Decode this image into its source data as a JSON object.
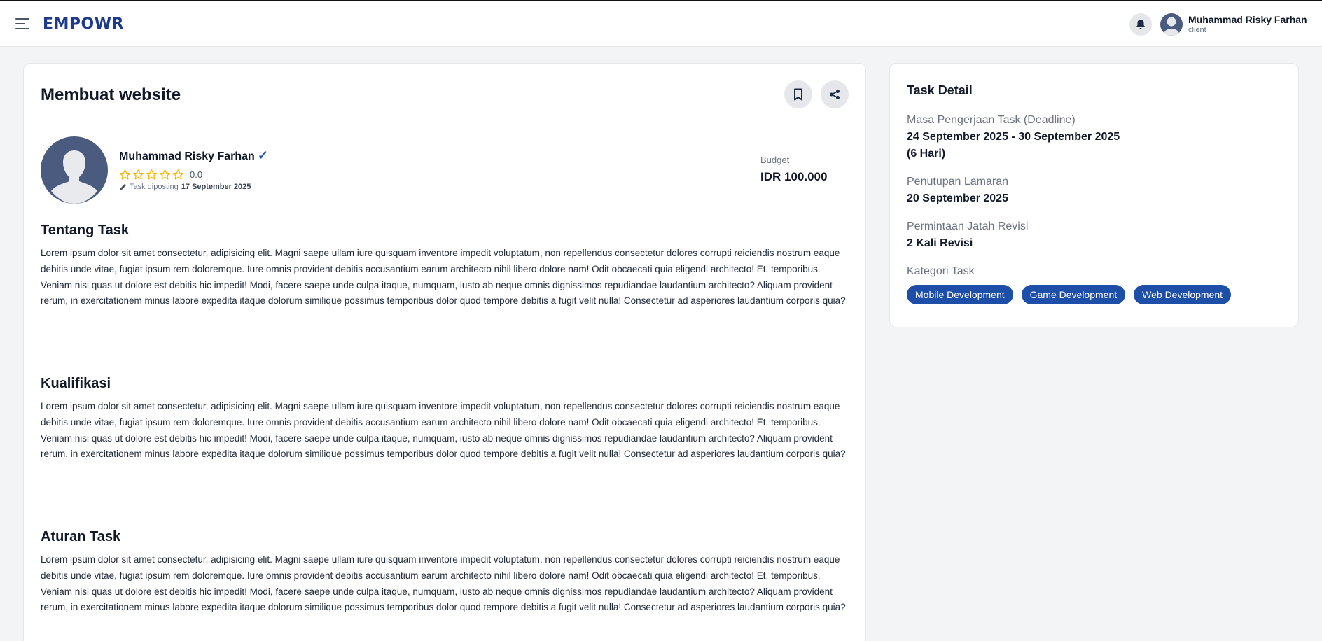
{
  "navbar": {
    "logo": "EMPOWR",
    "user_name": "Muhammad Risky Farhan",
    "user_role": "client"
  },
  "task": {
    "title": "Membuat website",
    "author": {
      "name": "Muhammad Risky Farhan",
      "verified_mark": "✓",
      "rating_value": "0.0",
      "rating_stars": 0,
      "rating_max": 5
    },
    "posted_label": "Task diposting",
    "posted_date": "17 September 2025",
    "budget_label": "Budget",
    "budget_value": "IDR 100.000",
    "sections": [
      {
        "title": "Tentang Task",
        "body": "Lorem ipsum dolor sit amet consectetur, adipisicing elit. Magni saepe ullam iure quisquam inventore impedit voluptatum, non repellendus consectetur dolores corrupti reiciendis nostrum eaque debitis unde vitae, fugiat ipsum rem doloremque. Iure omnis provident debitis accusantium earum architecto nihil libero dolore nam! Odit obcaecati quia eligendi architecto! Et, temporibus. Veniam nisi quas ut dolore est debitis hic impedit! Modi, facere saepe unde culpa itaque, numquam, iusto ab neque omnis dignissimos repudiandae laudantium architecto? Aliquam provident rerum, in exercitationem minus labore expedita itaque dolorum similique possimus temporibus dolor quod tempore debitis a fugit velit nulla! Consectetur ad asperiores laudantium corporis quia?"
      },
      {
        "title": "Kualifikasi",
        "body": "Lorem ipsum dolor sit amet consectetur, adipisicing elit. Magni saepe ullam iure quisquam inventore impedit voluptatum, non repellendus consectetur dolores corrupti reiciendis nostrum eaque debitis unde vitae, fugiat ipsum rem doloremque. Iure omnis provident debitis accusantium earum architecto nihil libero dolore nam! Odit obcaecati quia eligendi architecto! Et, temporibus. Veniam nisi quas ut dolore est debitis hic impedit! Modi, facere saepe unde culpa itaque, numquam, iusto ab neque omnis dignissimos repudiandae laudantium architecto? Aliquam provident rerum, in exercitationem minus labore expedita itaque dolorum similique possimus temporibus dolor quod tempore debitis a fugit velit nulla! Consectetur ad asperiores laudantium corporis quia?"
      },
      {
        "title": "Aturan Task",
        "body": "Lorem ipsum dolor sit amet consectetur, adipisicing elit. Magni saepe ullam iure quisquam inventore impedit voluptatum, non repellendus consectetur dolores corrupti reiciendis nostrum eaque debitis unde vitae, fugiat ipsum rem doloremque. Iure omnis provident debitis accusantium earum architecto nihil libero dolore nam! Odit obcaecati quia eligendi architecto! Et, temporibus. Veniam nisi quas ut dolore est debitis hic impedit! Modi, facere saepe unde culpa itaque, numquam, iusto ab neque omnis dignissimos repudiandae laudantium architecto? Aliquam provident rerum, in exercitationem minus labore expedita itaque dolorum similique possimus temporibus dolor quod tempore debitis a fugit velit nulla! Consectetur ad asperiores laudantium corporis quia?"
      }
    ]
  },
  "task_detail": {
    "title": "Task Detail",
    "deadline_label": "Masa Pengerjaan Task (Deadline)",
    "deadline_value": "24 September 2025 - 30 September 2025",
    "deadline_duration": "(6 Hari)",
    "closing_label": "Penutupan Lamaran",
    "closing_value": "20 September 2025",
    "revision_label": "Permintaan Jatah Revisi",
    "revision_value": "2 Kali Revisi",
    "category_label": "Kategori Task",
    "categories": [
      "Mobile Development",
      "Game Development",
      "Web Development"
    ]
  },
  "colors": {
    "brand": "#1e3a8a",
    "tag_bg": "#1e4fa8",
    "avatar_bg": "#4b5b80",
    "star": "#f5b301",
    "page_bg": "#f3f4f6"
  },
  "icons": {
    "menu": "hamburger-icon",
    "notifications": "bell-icon",
    "bookmark": "bookmark-icon",
    "share": "share-icon",
    "verified": "check-icon",
    "posted": "pencil-icon",
    "rating": "star-icon"
  }
}
